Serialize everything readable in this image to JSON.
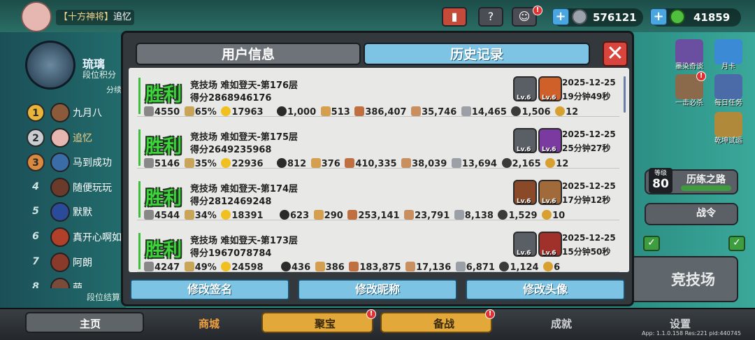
{
  "topbar": {
    "player_title": "【十方神将】",
    "player_name": "追忆",
    "coins": "576121",
    "gems": "41859",
    "badge": "!"
  },
  "left_panel": {
    "guild_name": "琉璃",
    "rank_points_label": "段位积分",
    "score_label": "分续",
    "footer": "段位结算",
    "rankings": [
      {
        "rank": "1",
        "name": "九月八"
      },
      {
        "rank": "2",
        "name": "追忆"
      },
      {
        "rank": "3",
        "name": "马到成功"
      },
      {
        "rank": "4",
        "name": "随便玩玩"
      },
      {
        "rank": "5",
        "name": "默默"
      },
      {
        "rank": "6",
        "name": "真开心啊如"
      },
      {
        "rank": "7",
        "name": "阿朗"
      },
      {
        "rank": "8",
        "name": "萌"
      }
    ]
  },
  "right_panel": {
    "items": [
      "墨染奇谈",
      "月卡",
      "一击必杀",
      "每日任务",
      "乾坤试运"
    ],
    "level_label": "等级",
    "level": "80",
    "path_label": "历练之路",
    "war_label": "战令",
    "arena_label": "竞技场"
  },
  "modal": {
    "tab_user_info": "用户信息",
    "tab_history": "历史记录",
    "close": "✕",
    "records": [
      {
        "result": "胜利",
        "title": "竞技场 难如登天-第176层",
        "score": "得分2868946176",
        "date": "2025-12-25",
        "duration": "19分钟49秒",
        "hero1_level": "Lv.6",
        "hero2_level": "Lv.6",
        "stats_a": [
          "4550",
          "65%",
          "17963"
        ],
        "stats_b": [
          "1,000",
          "513",
          "386,407",
          "35,746",
          "14,465",
          "1,506",
          "12"
        ]
      },
      {
        "result": "胜利",
        "title": "竞技场 难如登天-第175层",
        "score": "得分2649235968",
        "date": "2025-12-25",
        "duration": "25分钟27秒",
        "hero1_level": "Lv.6",
        "hero2_level": "Lv.6",
        "stats_a": [
          "5146",
          "35%",
          "22936"
        ],
        "stats_b": [
          "812",
          "376",
          "410,335",
          "38,039",
          "13,694",
          "2,165",
          "12"
        ]
      },
      {
        "result": "胜利",
        "title": "竞技场 难如登天-第174层",
        "score": "得分2812469248",
        "date": "2025-12-25",
        "duration": "17分钟12秒",
        "hero1_level": "Lv.6",
        "hero2_level": "Lv.6",
        "stats_a": [
          "4544",
          "34%",
          "18391"
        ],
        "stats_b": [
          "623",
          "290",
          "253,141",
          "23,791",
          "8,138",
          "1,529",
          "10"
        ]
      },
      {
        "result": "胜利",
        "title": "竞技场 难如登天-第173层",
        "score": "得分1967078784",
        "date": "2025-12-25",
        "duration": "15分钟50秒",
        "hero1_level": "Lv.6",
        "hero2_level": "Lv.6",
        "stats_a": [
          "4247",
          "49%",
          "24598"
        ],
        "stats_b": [
          "436",
          "386",
          "183,875",
          "17,136",
          "6,871",
          "1,124",
          "6"
        ]
      }
    ],
    "buttons": {
      "edit_signature": "修改签名",
      "edit_nickname": "修改昵称",
      "edit_avatar": "修改头像"
    }
  },
  "bottom_nav": {
    "home": "主页",
    "shop": "商城",
    "treasure": "聚宝",
    "prepare": "备战",
    "achievement": "成就",
    "settings": "设置"
  },
  "footer_info": "App: 1.1.0.158 Res:221 pid:440745",
  "colors": {
    "victory_green": "#3ed43c",
    "tab_active": "#7dc4e4",
    "close_red": "#d8453c",
    "modal_bg": "#33383d",
    "list_bg": "#e8e8e6"
  }
}
